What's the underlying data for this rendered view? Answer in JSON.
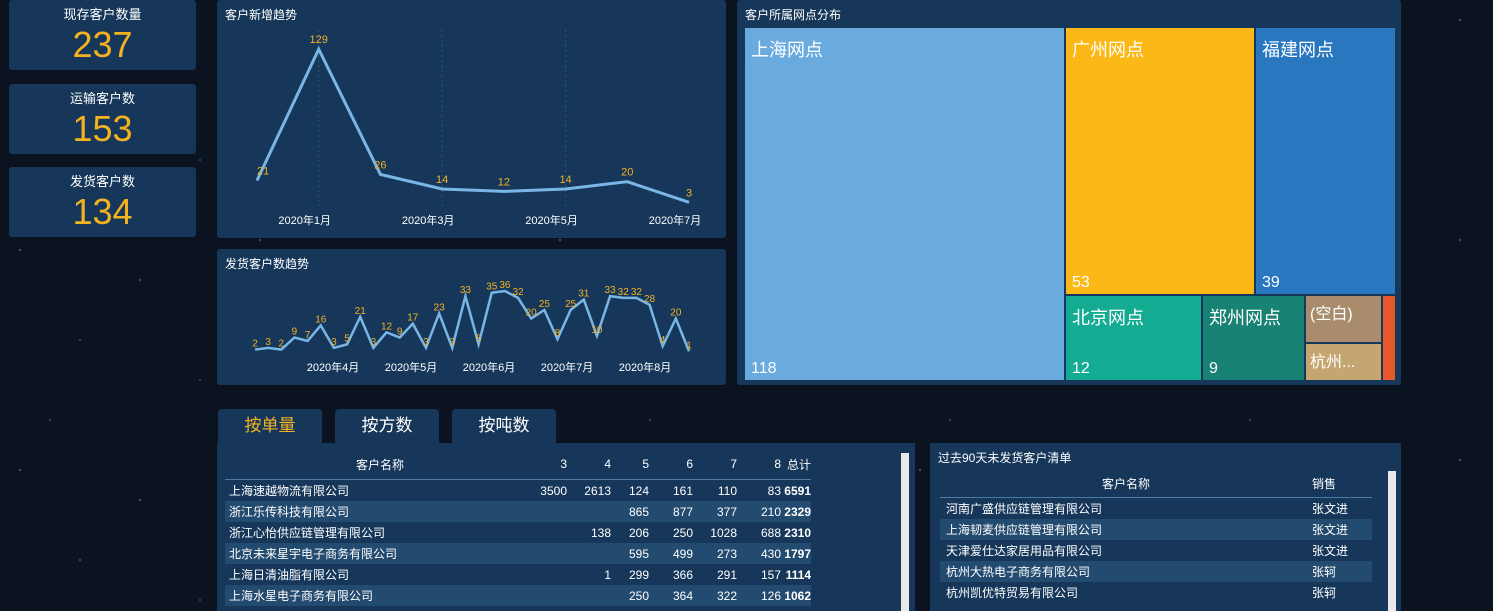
{
  "kpis": [
    {
      "label": "现存客户数量",
      "value": "237"
    },
    {
      "label": "运输客户数",
      "value": "153"
    },
    {
      "label": "发货客户数",
      "value": "134"
    }
  ],
  "new_trend": {
    "title": "客户新增趋势",
    "values": [
      21,
      129,
      26,
      14,
      12,
      14,
      20,
      3
    ],
    "x_labels": [
      "2020年1月",
      "2020年3月",
      "2020年5月",
      "2020年7月"
    ]
  },
  "ship_trend": {
    "title": "发货客户数趋势",
    "labels": [
      "2",
      "3",
      "2",
      "9",
      "7",
      "16",
      "3",
      "5",
      "21",
      "3",
      "12",
      "9",
      "17",
      "3",
      "23",
      "3",
      "33",
      "5",
      "35",
      "36",
      "32",
      "20",
      "25",
      "8",
      "25",
      "31",
      "10",
      "33",
      "32",
      "32",
      "28",
      "4",
      "20",
      "1"
    ],
    "x_labels": [
      "2020年4月",
      "2020年5月",
      "2020年6月",
      "2020年7月",
      "2020年8月"
    ]
  },
  "treemap": {
    "title": "客户所属网点分布",
    "cells": [
      {
        "name": "上海网点",
        "value": "118",
        "color": "#6aabdf"
      },
      {
        "name": "广州网点",
        "value": "53",
        "color": "#fbb817"
      },
      {
        "name": "福建网点",
        "value": "39",
        "color": "#2877bf"
      },
      {
        "name": "北京网点",
        "value": "12",
        "color": "#13ac92"
      },
      {
        "name": "郑州网点",
        "value": "9",
        "color": "#188274"
      },
      {
        "name": "(空白)",
        "value": "",
        "color": "#a88c6c"
      },
      {
        "name": "杭州...",
        "value": "",
        "color": "#c6a670"
      },
      {
        "name": "",
        "value": "",
        "color": "#e8582a"
      }
    ]
  },
  "tabs": [
    "按单量",
    "按方数",
    "按吨数"
  ],
  "volume_table": {
    "headers": [
      "客户名称",
      "3",
      "4",
      "5",
      "6",
      "7",
      "8",
      "总计"
    ],
    "rows": [
      [
        "上海速越物流有限公司",
        "3500",
        "2613",
        "124",
        "161",
        "110",
        "83",
        "6591"
      ],
      [
        "浙江乐传科技有限公司",
        "",
        "",
        "865",
        "877",
        "377",
        "210",
        "2329"
      ],
      [
        "浙江心怡供应链管理有限公司",
        "",
        "138",
        "206",
        "250",
        "1028",
        "688",
        "2310"
      ],
      [
        "北京未来星宇电子商务有限公司",
        "",
        "",
        "595",
        "499",
        "273",
        "430",
        "1797"
      ],
      [
        "上海日清油脂有限公司",
        "",
        "1",
        "299",
        "366",
        "291",
        "157",
        "1114"
      ],
      [
        "上海水星电子商务有限公司",
        "",
        "",
        "250",
        "364",
        "322",
        "126",
        "1062"
      ]
    ]
  },
  "inactive_list": {
    "title": "过去90天未发货客户清单",
    "headers": [
      "客户名称",
      "销售"
    ],
    "rows": [
      [
        "河南广盛供应链管理有限公司",
        "张文进"
      ],
      [
        "上海韧麦供应链管理有限公司",
        "张文进"
      ],
      [
        "天津爱仕达家居用品有限公司",
        "张文进"
      ],
      [
        "杭州大热电子商务有限公司",
        "张轲"
      ],
      [
        "杭州凯优特贸易有限公司",
        "张轲"
      ]
    ]
  }
}
